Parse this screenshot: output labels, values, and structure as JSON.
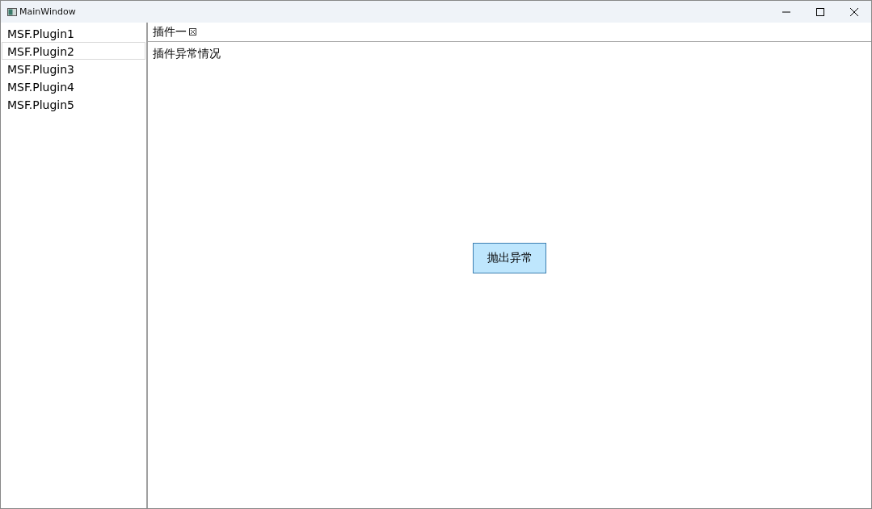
{
  "window": {
    "title": "MainWindow"
  },
  "sidebar": {
    "items": [
      {
        "label": "MSF.Plugin1",
        "selected": false
      },
      {
        "label": "MSF.Plugin2",
        "selected": true
      },
      {
        "label": "MSF.Plugin3",
        "selected": false
      },
      {
        "label": "MSF.Plugin4",
        "selected": false
      },
      {
        "label": "MSF.Plugin5",
        "selected": false
      }
    ]
  },
  "tabs": [
    {
      "label": "插件一",
      "selected": true
    }
  ],
  "content": {
    "label": "插件异常情况",
    "button": "抛出异常"
  }
}
